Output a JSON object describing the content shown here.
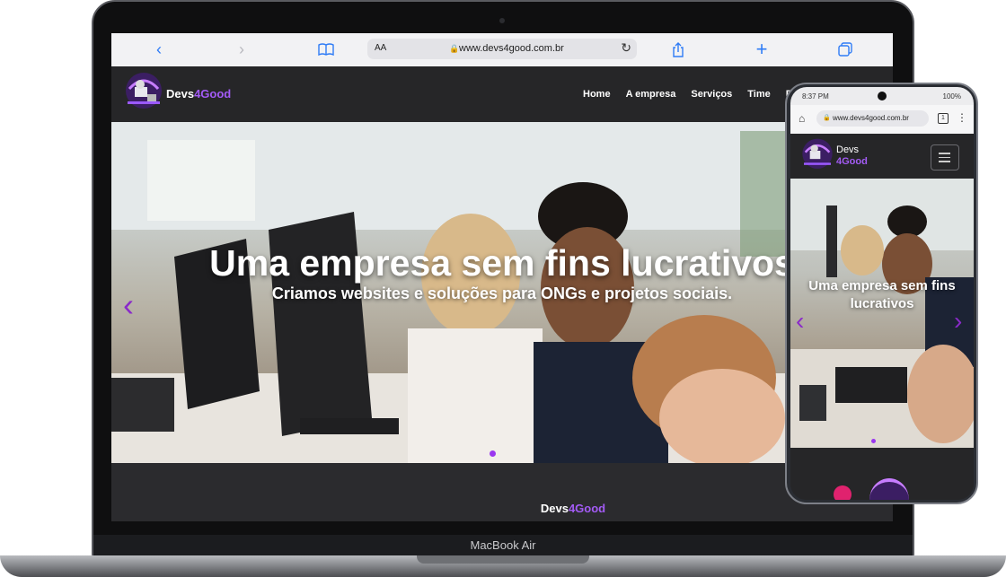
{
  "device": {
    "laptop_label": "MacBook Air"
  },
  "browser": {
    "text_size_label": "AA",
    "url": "www.devs4good.com.br",
    "icons": [
      "back-icon",
      "forward-icon",
      "bookmarks-icon",
      "reload-icon",
      "share-icon",
      "new-tab-icon",
      "tabs-icon"
    ]
  },
  "site": {
    "brand_prefix": "Devs",
    "brand_accent": "4Good",
    "accent_color": "#a35bf5",
    "nav": [
      "Home",
      "A empresa",
      "Serviços",
      "Time",
      "B"
    ],
    "hero_title": "Uma empresa sem fins lucrativos",
    "hero_subtitle": "Criamos websites e soluções para ONGs e projetos sociais.",
    "footer_brand_prefix": "Devs",
    "footer_brand_accent": "4Good"
  },
  "phone": {
    "time": "8:37 PM",
    "battery": "100%",
    "url": "www.devs4good.com.br",
    "tab_count": "1",
    "brand_line1": "Devs",
    "brand_line2": "4Good",
    "hero_title": "Uma empresa sem fins lucrativos"
  }
}
